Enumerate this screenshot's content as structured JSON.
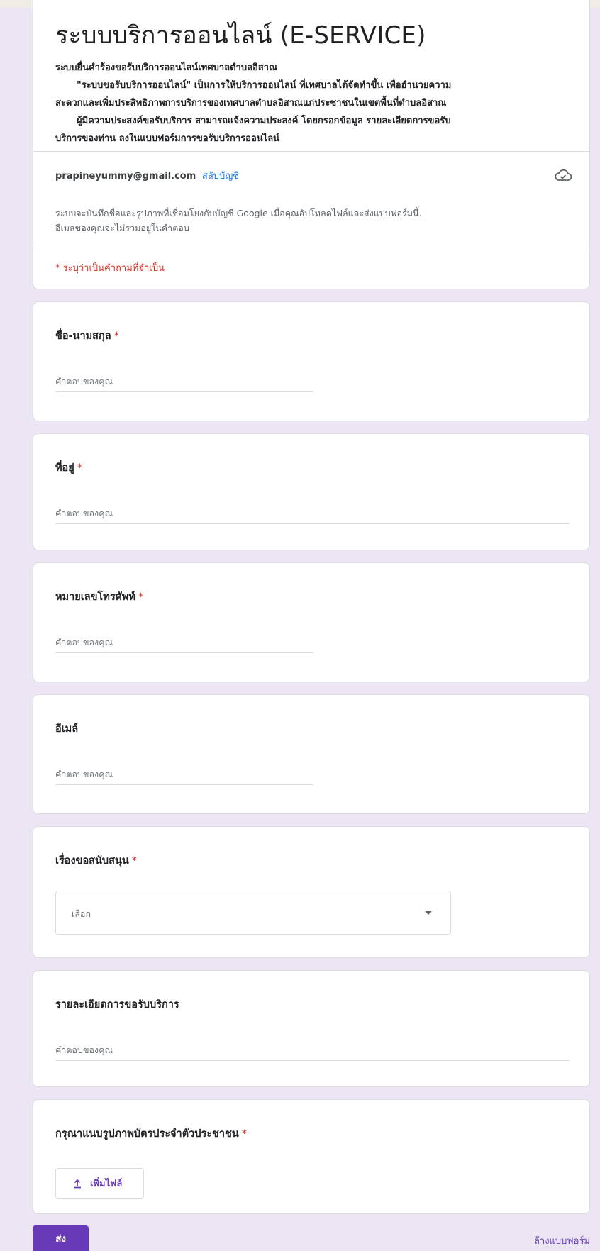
{
  "header": {
    "title": "ระบบบริการออนไลน์ (E-SERVICE)",
    "description_lines": [
      "ระบบยื่นคำร้องขอรับบริการออนไลน์เทศบาลตำบลอิสาณ",
      "\"ระบบขอรับบริการออนไลน์\" เป็นการให้บริการออนไลน์ ที่เทศบาลได้จัดทำขึ้น เพื่ออำนวยความ",
      "สะดวกและเพิ่มประสิทธิภาพการบริการของเทศบาลตำบลอิสาณแก่ประชาชนในเขตพื้นที่ตำบลอิสาณ",
      "ผู้มีความประสงค์ขอรับบริการ สามารถแจ้งความประสงค์ โดยกรอกข้อมูล รายละเอียดการขอรับ",
      "บริการของท่าน ลงในแบบฟอร์มการขอรับบริการออนไลน์"
    ],
    "account_email": "prapineyummy@gmail.com",
    "switch_account": "สลับบัญชี",
    "notice_line1": "ระบบจะบันทึกชื่อและรูปภาพที่เชื่อมโยงกับบัญชี Google เมื่อคุณอัปโหลดไฟล์และส่งแบบฟอร์มนี้.",
    "notice_line2": "อีเมลของคุณจะไม่รวมอยู่ในคำตอบ",
    "required_note": "* ระบุว่าเป็นคำถามที่จำเป็น"
  },
  "questions": {
    "name": {
      "title": "ชื่อ-นามสกุล",
      "required": "*",
      "placeholder": "คำตอบของคุณ",
      "value": ""
    },
    "address": {
      "title": "ที่อยู่",
      "required": "*",
      "placeholder": "คำตอบของคุณ",
      "value": ""
    },
    "phone": {
      "title": "หมายเลขโทรศัพท์",
      "required": "*",
      "placeholder": "คำตอบของคุณ",
      "value": ""
    },
    "email": {
      "title": "อีเมล์",
      "placeholder": "คำตอบของคุณ",
      "value": ""
    },
    "support_topic": {
      "title": "เรื่องขอสนับสนุน",
      "required": "*",
      "selected": "เลือก"
    },
    "details": {
      "title": "รายละเอียดการขอรับบริการ",
      "placeholder": "คำตอบของคุณ",
      "value": ""
    },
    "id_card": {
      "title": "กรุณาแนบรูปภาพบัตรประจำตัวประชาชน",
      "required": "*",
      "upload_label": "เพิ่มไฟล์"
    }
  },
  "footer": {
    "submit": "ส่ง",
    "clear_form": "ล้างแบบฟอร์ม"
  },
  "colors": {
    "background": "#ece6f4",
    "accent": "#673ab7",
    "required": "#d93025",
    "link": "#1a73e8"
  },
  "icons": {
    "cloud": "cloud-save-icon",
    "upload": "upload-icon",
    "dropdown": "caret-down-icon"
  }
}
